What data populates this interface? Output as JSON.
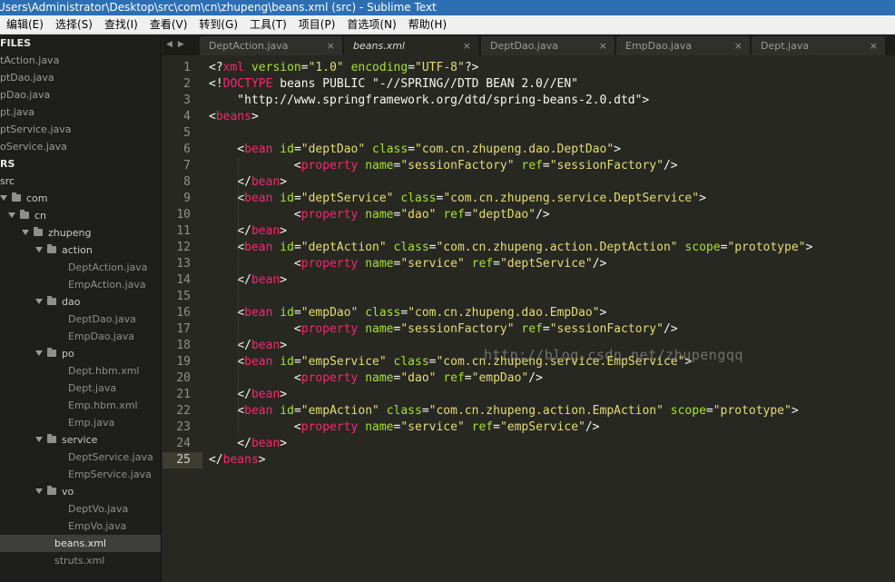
{
  "window": {
    "title": "Users\\Administrator\\Desktop\\src\\com\\cn\\zhupeng\\beans.xml (src) - Sublime Text"
  },
  "menu": [
    "编辑(E)",
    "选择(S)",
    "查找(I)",
    "查看(V)",
    "转到(G)",
    "工具(T)",
    "项目(P)",
    "首选项(N)",
    "帮助(H)"
  ],
  "sidebar": {
    "open_files_header": "FILES",
    "open_files": [
      "tAction.java",
      "ptDao.java",
      "pDao.java",
      "pt.java",
      "ptService.java",
      "oService.java"
    ],
    "folders_header": "RS",
    "tree": [
      {
        "label": "src",
        "kind": "root"
      },
      {
        "label": "com",
        "kind": "folder"
      },
      {
        "label": "cn",
        "kind": "folder"
      },
      {
        "label": "zhupeng",
        "kind": "folder"
      },
      {
        "label": "action",
        "kind": "folder"
      },
      {
        "label": "DeptAction.java",
        "kind": "file"
      },
      {
        "label": "EmpAction.java",
        "kind": "file"
      },
      {
        "label": "dao",
        "kind": "folder"
      },
      {
        "label": "DeptDao.java",
        "kind": "file"
      },
      {
        "label": "EmpDao.java",
        "kind": "file"
      },
      {
        "label": "po",
        "kind": "folder"
      },
      {
        "label": "Dept.hbm.xml",
        "kind": "file"
      },
      {
        "label": "Dept.java",
        "kind": "file"
      },
      {
        "label": "Emp.hbm.xml",
        "kind": "file"
      },
      {
        "label": "Emp.java",
        "kind": "file"
      },
      {
        "label": "service",
        "kind": "folder"
      },
      {
        "label": "DeptService.java",
        "kind": "file"
      },
      {
        "label": "EmpService.java",
        "kind": "file"
      },
      {
        "label": "vo",
        "kind": "folder"
      },
      {
        "label": "DeptVo.java",
        "kind": "file"
      },
      {
        "label": "EmpVo.java",
        "kind": "file"
      },
      {
        "label": "beans.xml",
        "kind": "file",
        "selected": true
      },
      {
        "label": "struts.xml",
        "kind": "file"
      }
    ]
  },
  "tabs": [
    {
      "label": "DeptAction.java",
      "active": false
    },
    {
      "label": "beans.xml",
      "active": true
    },
    {
      "label": "DeptDao.java",
      "active": false
    },
    {
      "label": "EmpDao.java",
      "active": false
    },
    {
      "label": "Dept.java",
      "active": false
    }
  ],
  "tab_close_glyph": "×",
  "tab_nav": [
    "◀",
    "▶"
  ],
  "editor": {
    "active_line": 25,
    "line_numbers": [
      "1",
      "2",
      "3",
      "4",
      "5",
      "6",
      "7",
      "8",
      "9",
      "10",
      "11",
      "12",
      "13",
      "14",
      "15",
      "16",
      "17",
      "18",
      "19",
      "20",
      "21",
      "22",
      "23",
      "24",
      "25"
    ],
    "lines": [
      [
        [
          "p",
          "<?"
        ],
        [
          "t",
          "xml"
        ],
        [
          "p",
          " "
        ],
        [
          "a",
          "version"
        ],
        [
          "p",
          "="
        ],
        [
          "s",
          "\"1.0\""
        ],
        [
          "p",
          " "
        ],
        [
          "a",
          "encoding"
        ],
        [
          "p",
          "="
        ],
        [
          "s",
          "\"UTF-8\""
        ],
        [
          "p",
          "?>"
        ]
      ],
      [
        [
          "p",
          "<!"
        ],
        [
          "t",
          "DOCTYPE"
        ],
        [
          "p",
          " beans PUBLIC \"-//SPRING//DTD BEAN 2.0//EN\""
        ]
      ],
      [
        [
          "p",
          "    \"http://www.springframework.org/dtd/spring-beans-2.0.dtd\">"
        ]
      ],
      [
        [
          "p",
          "<"
        ],
        [
          "t",
          "beans"
        ],
        [
          "p",
          ">"
        ]
      ],
      [],
      [
        [
          "p",
          "    <"
        ],
        [
          "t",
          "bean"
        ],
        [
          "p",
          " "
        ],
        [
          "a",
          "id"
        ],
        [
          "p",
          "="
        ],
        [
          "s",
          "\"deptDao\""
        ],
        [
          "p",
          " "
        ],
        [
          "a",
          "class"
        ],
        [
          "p",
          "="
        ],
        [
          "s",
          "\"com.cn.zhupeng.dao.DeptDao\""
        ],
        [
          "p",
          ">"
        ]
      ],
      [
        [
          "p",
          "            <"
        ],
        [
          "t",
          "property"
        ],
        [
          "p",
          " "
        ],
        [
          "a",
          "name"
        ],
        [
          "p",
          "="
        ],
        [
          "s",
          "\"sessionFactory\""
        ],
        [
          "p",
          " "
        ],
        [
          "a",
          "ref"
        ],
        [
          "p",
          "="
        ],
        [
          "s",
          "\"sessionFactory\""
        ],
        [
          "p",
          "/>"
        ]
      ],
      [
        [
          "p",
          "    </"
        ],
        [
          "t",
          "bean"
        ],
        [
          "p",
          ">"
        ]
      ],
      [
        [
          "p",
          "    <"
        ],
        [
          "t",
          "bean"
        ],
        [
          "p",
          " "
        ],
        [
          "a",
          "id"
        ],
        [
          "p",
          "="
        ],
        [
          "s",
          "\"deptService\""
        ],
        [
          "p",
          " "
        ],
        [
          "a",
          "class"
        ],
        [
          "p",
          "="
        ],
        [
          "s",
          "\"com.cn.zhupeng.service.DeptService\""
        ],
        [
          "p",
          ">"
        ]
      ],
      [
        [
          "p",
          "            <"
        ],
        [
          "t",
          "property"
        ],
        [
          "p",
          " "
        ],
        [
          "a",
          "name"
        ],
        [
          "p",
          "="
        ],
        [
          "s",
          "\"dao\""
        ],
        [
          "p",
          " "
        ],
        [
          "a",
          "ref"
        ],
        [
          "p",
          "="
        ],
        [
          "s",
          "\"deptDao\""
        ],
        [
          "p",
          "/>"
        ]
      ],
      [
        [
          "p",
          "    </"
        ],
        [
          "t",
          "bean"
        ],
        [
          "p",
          ">"
        ]
      ],
      [
        [
          "p",
          "    <"
        ],
        [
          "t",
          "bean"
        ],
        [
          "p",
          " "
        ],
        [
          "a",
          "id"
        ],
        [
          "p",
          "="
        ],
        [
          "s",
          "\"deptAction\""
        ],
        [
          "p",
          " "
        ],
        [
          "a",
          "class"
        ],
        [
          "p",
          "="
        ],
        [
          "s",
          "\"com.cn.zhupeng.action.DeptAction\""
        ],
        [
          "p",
          " "
        ],
        [
          "a",
          "scope"
        ],
        [
          "p",
          "="
        ],
        [
          "s",
          "\"prototype\""
        ],
        [
          "p",
          ">"
        ]
      ],
      [
        [
          "p",
          "            <"
        ],
        [
          "t",
          "property"
        ],
        [
          "p",
          " "
        ],
        [
          "a",
          "name"
        ],
        [
          "p",
          "="
        ],
        [
          "s",
          "\"service\""
        ],
        [
          "p",
          " "
        ],
        [
          "a",
          "ref"
        ],
        [
          "p",
          "="
        ],
        [
          "s",
          "\"deptService\""
        ],
        [
          "p",
          "/>"
        ]
      ],
      [
        [
          "p",
          "    </"
        ],
        [
          "t",
          "bean"
        ],
        [
          "p",
          ">"
        ]
      ],
      [],
      [
        [
          "p",
          "    <"
        ],
        [
          "t",
          "bean"
        ],
        [
          "p",
          " "
        ],
        [
          "a",
          "id"
        ],
        [
          "p",
          "="
        ],
        [
          "s",
          "\"empDao\""
        ],
        [
          "p",
          " "
        ],
        [
          "a",
          "class"
        ],
        [
          "p",
          "="
        ],
        [
          "s",
          "\"com.cn.zhupeng.dao.EmpDao\""
        ],
        [
          "p",
          ">"
        ]
      ],
      [
        [
          "p",
          "            <"
        ],
        [
          "t",
          "property"
        ],
        [
          "p",
          " "
        ],
        [
          "a",
          "name"
        ],
        [
          "p",
          "="
        ],
        [
          "s",
          "\"sessionFactory\""
        ],
        [
          "p",
          " "
        ],
        [
          "a",
          "ref"
        ],
        [
          "p",
          "="
        ],
        [
          "s",
          "\"sessionFactory\""
        ],
        [
          "p",
          "/>"
        ]
      ],
      [
        [
          "p",
          "    </"
        ],
        [
          "t",
          "bean"
        ],
        [
          "p",
          ">"
        ]
      ],
      [
        [
          "p",
          "    <"
        ],
        [
          "t",
          "bean"
        ],
        [
          "p",
          " "
        ],
        [
          "a",
          "id"
        ],
        [
          "p",
          "="
        ],
        [
          "s",
          "\"empService\""
        ],
        [
          "p",
          " "
        ],
        [
          "a",
          "class"
        ],
        [
          "p",
          "="
        ],
        [
          "s",
          "\"com.cn.zhupeng.service.EmpService\""
        ],
        [
          "p",
          ">"
        ]
      ],
      [
        [
          "p",
          "            <"
        ],
        [
          "t",
          "property"
        ],
        [
          "p",
          " "
        ],
        [
          "a",
          "name"
        ],
        [
          "p",
          "="
        ],
        [
          "s",
          "\"dao\""
        ],
        [
          "p",
          " "
        ],
        [
          "a",
          "ref"
        ],
        [
          "p",
          "="
        ],
        [
          "s",
          "\"empDao\""
        ],
        [
          "p",
          "/>"
        ]
      ],
      [
        [
          "p",
          "    </"
        ],
        [
          "t",
          "bean"
        ],
        [
          "p",
          ">"
        ]
      ],
      [
        [
          "p",
          "    <"
        ],
        [
          "t",
          "bean"
        ],
        [
          "p",
          " "
        ],
        [
          "a",
          "id"
        ],
        [
          "p",
          "="
        ],
        [
          "s",
          "\"empAction\""
        ],
        [
          "p",
          " "
        ],
        [
          "a",
          "class"
        ],
        [
          "p",
          "="
        ],
        [
          "s",
          "\"com.cn.zhupeng.action.EmpAction\""
        ],
        [
          "p",
          " "
        ],
        [
          "a",
          "scope"
        ],
        [
          "p",
          "="
        ],
        [
          "s",
          "\"prototype\""
        ],
        [
          "p",
          ">"
        ]
      ],
      [
        [
          "p",
          "            <"
        ],
        [
          "t",
          "property"
        ],
        [
          "p",
          " "
        ],
        [
          "a",
          "name"
        ],
        [
          "p",
          "="
        ],
        [
          "s",
          "\"service\""
        ],
        [
          "p",
          " "
        ],
        [
          "a",
          "ref"
        ],
        [
          "p",
          "="
        ],
        [
          "s",
          "\"empService\""
        ],
        [
          "p",
          "/>"
        ]
      ],
      [
        [
          "p",
          "    </"
        ],
        [
          "t",
          "bean"
        ],
        [
          "p",
          ">"
        ]
      ],
      [
        [
          "p",
          "</"
        ],
        [
          "t",
          "beans"
        ],
        [
          "p",
          ">"
        ]
      ]
    ],
    "watermark": "http://blog.csdn.net/zhupengqq"
  },
  "colors": {
    "tag": "#f92672",
    "attribute": "#a6e22e",
    "string": "#e6db74",
    "text": "#f8f8f2",
    "background": "#272822",
    "title_bar": "#2d6fb3"
  }
}
